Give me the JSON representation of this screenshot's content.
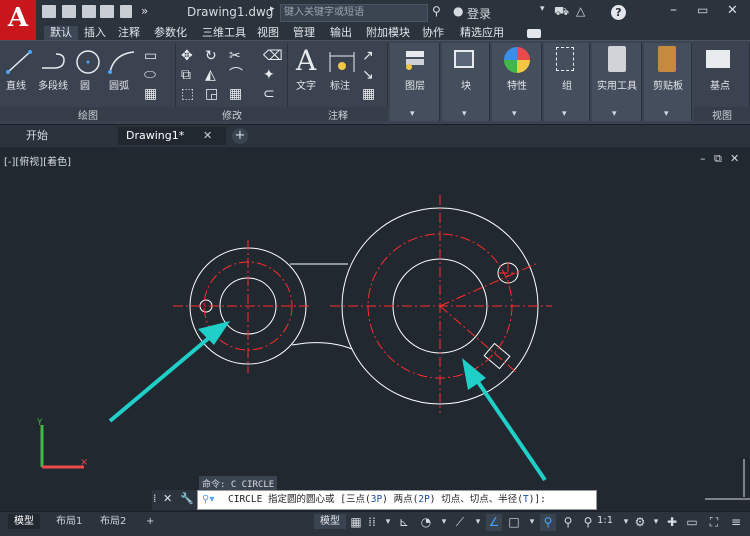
{
  "titlebar": {
    "logo_letter": "A",
    "filename": "Drawing1.dwg",
    "search_placeholder": "键入关键字或短语",
    "login_label": "登录",
    "help_label": "?",
    "window_controls": [
      "minimize-icon",
      "restore-icon",
      "close-icon"
    ]
  },
  "menu": {
    "items": [
      "默认",
      "插入",
      "注释",
      "参数化",
      "三维工具",
      "视图",
      "管理",
      "输出",
      "附加模块",
      "协作",
      "精选应用"
    ]
  },
  "ribbon": {
    "draw": {
      "label": "绘图",
      "tools": [
        "直线",
        "多段线",
        "圆",
        "圆弧"
      ]
    },
    "modify": {
      "label": "修改"
    },
    "annotation": {
      "label": "注释",
      "tools": [
        "文字",
        "标注"
      ]
    },
    "layers": {
      "label": "图层"
    },
    "block": {
      "label": "块"
    },
    "properties": {
      "label": "特性"
    },
    "groups": {
      "label": "组"
    },
    "utilities": {
      "label": "实用工具"
    },
    "clipboard": {
      "label": "剪贴板"
    },
    "view": {
      "label": "视图",
      "tool": "基点"
    }
  },
  "tabs": {
    "start": "开始",
    "drawing": "Drawing1*",
    "add": "+"
  },
  "viewport": {
    "label": "[-][俯视][着色]",
    "controls": [
      "minimize-icon",
      "restore-icon",
      "close-icon"
    ]
  },
  "command": {
    "history": "命令: C CIRCLE",
    "prompt_main": "CIRCLE 指定圆的圆心或 [",
    "opt1": "三点(",
    "opt1_key": "3P",
    "opt2_pre": ") 两点(",
    "opt2_key": "2P",
    "opt3_pre": ") 切点、切点、半径(",
    "opt3_key": "T",
    "prompt_end": ")]:"
  },
  "layouts": [
    "模型",
    "布局1",
    "布局2",
    "+"
  ],
  "status": {
    "model_label": "模型",
    "scale_label": "1:1"
  },
  "colors": {
    "geometry": "#ffffff",
    "centerline": "#ff2b2b",
    "arrow": "#1fcfc8",
    "logo": "#c8161d"
  }
}
